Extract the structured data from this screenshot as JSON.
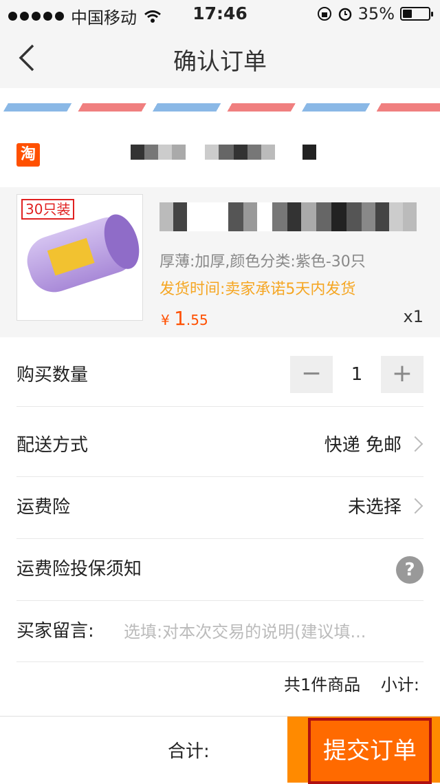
{
  "status_bar": {
    "carrier": "中国移动",
    "time": "17:46",
    "battery": "35%",
    "battery_level": 0.35
  },
  "nav": {
    "title": "确认订单"
  },
  "shop": {
    "logo_text": "淘"
  },
  "item": {
    "badge": "30只装",
    "spec": "厚薄:加厚,颜色分类:紫色-30只",
    "ship_time": "发货时间:卖家承诺5天内发货",
    "price_symbol": "¥",
    "price_int": "1",
    "price_dec": ".55",
    "quantity_x": "x1"
  },
  "rows": {
    "quantity_label": "购买数量",
    "quantity_value": "1",
    "minus": "−",
    "plus": "+",
    "delivery_label": "配送方式",
    "delivery_value": "快递 免邮",
    "insurance_label": "运费险",
    "insurance_value": "未选择",
    "notice_label": "运费险投保须知",
    "help": "?",
    "message_label": "买家留言:",
    "message_placeholder": "选填:对本次交易的说明(建议填..."
  },
  "summary": {
    "count": "共1件商品",
    "subtotal": "小计:"
  },
  "bottom": {
    "total_label": "合计:",
    "submit": "提交订单"
  }
}
